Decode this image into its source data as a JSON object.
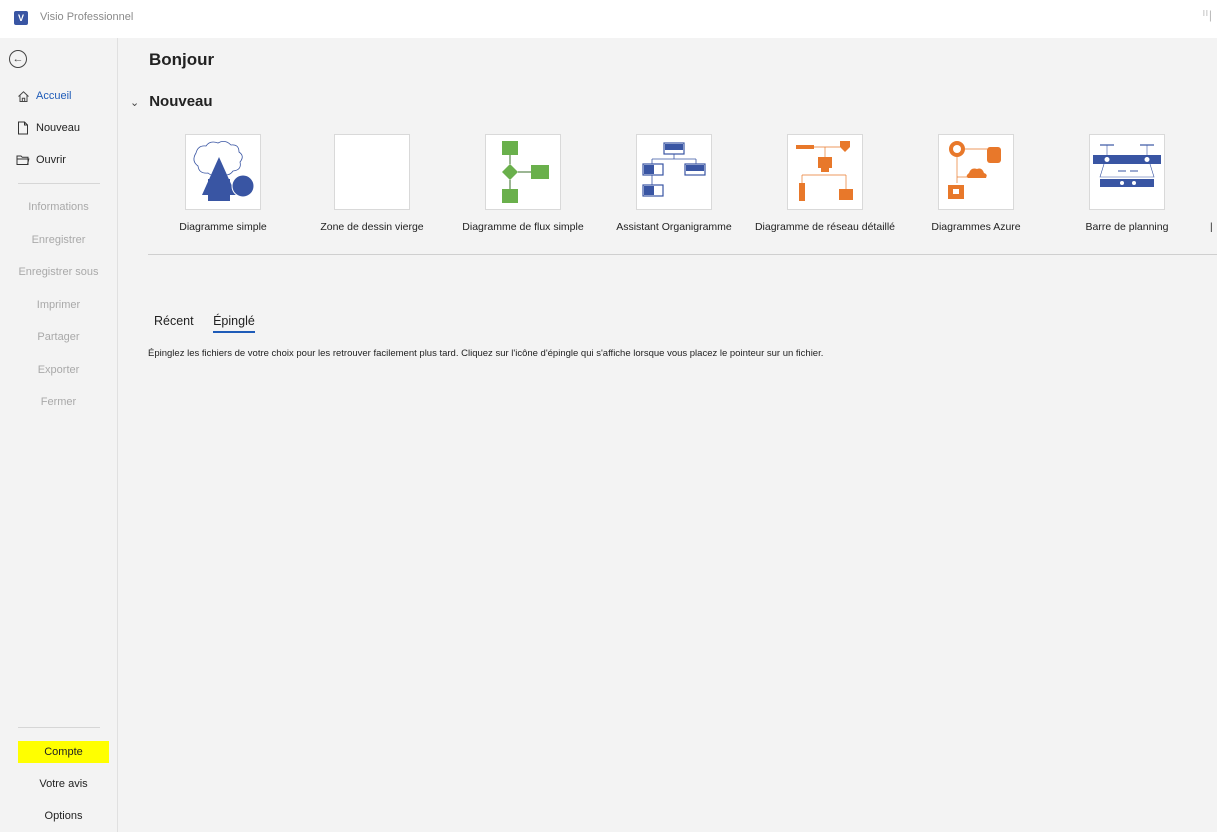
{
  "app": {
    "title": "Visio Professionnel",
    "icon_letter": "V"
  },
  "sidebar": {
    "primary": [
      {
        "label": "Accueil",
        "icon": "home-icon",
        "active": true
      },
      {
        "label": "Nouveau",
        "icon": "new-file-icon",
        "active": false
      },
      {
        "label": "Ouvrir",
        "icon": "folder-icon",
        "active": false
      }
    ],
    "disabled": [
      "Informations",
      "Enregistrer",
      "Enregistrer sous",
      "Imprimer",
      "Partager",
      "Exporter",
      "Fermer"
    ],
    "bottom": [
      {
        "label": "Compte",
        "highlighted": true
      },
      {
        "label": "Votre avis",
        "highlighted": false
      },
      {
        "label": "Options",
        "highlighted": false
      }
    ]
  },
  "main": {
    "greeting": "Bonjour",
    "new_section": "Nouveau",
    "templates": [
      "Diagramme simple",
      "Zone de dessin vierge",
      "Diagramme de flux simple",
      "Assistant Organigramme",
      "Diagramme de réseau détaillé",
      "Diagrammes Azure",
      "Barre de planning"
    ],
    "tabs": [
      {
        "label": "Récent",
        "selected": false
      },
      {
        "label": "Épinglé",
        "selected": true
      }
    ],
    "pinned_message": "Épinglez les fichiers de votre choix pour les retrouver facilement plus tard. Cliquez sur l'icône d'épingle qui s'affiche lorsque vous placez le pointeur sur un fichier."
  },
  "colors": {
    "accent": "#1e5bb8",
    "highlight": "#ffff00",
    "shape_blue": "#3955a3",
    "flow_green": "#6ab04c",
    "network_orange": "#e8782a"
  }
}
